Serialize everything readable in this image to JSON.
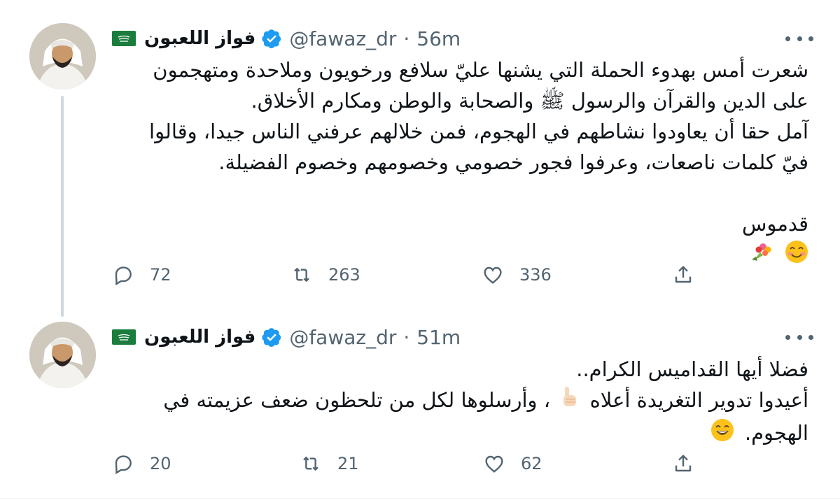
{
  "tweets": [
    {
      "author_name": "فواز اللعبون",
      "handle": "@fawaz_dr",
      "separator": "·",
      "time": "56m",
      "flag_icon": "saudi-flag-icon",
      "lines": [
        "شعرت أمس بهدوء الحملة التي يشنها عليّ سلافع ورخويون وملاحدة ومتهجمون",
        "على الدين والقرآن والرسول ﷺ والصحابة والوطن ومكارم الأخلاق.",
        "آمل حقا أن يعاودوا نشاطهم في الهجوم، فمن خلالهم عرفني الناس جيدا، وقالوا",
        "فيّ كلمات ناصعات، وعرفوا فجور خصومي وخصومهم وخصوم الفضيلة.",
        "",
        "قدموس"
      ],
      "emoji_line": [
        "smiling-face-emoji",
        "bouquet-emoji"
      ],
      "replies": "72",
      "retweets": "263",
      "likes": "336"
    },
    {
      "author_name": "فواز اللعبون",
      "handle": "@fawaz_dr",
      "separator": "·",
      "time": "51m",
      "flag_icon": "saudi-flag-icon",
      "lines": [
        "فضلا أيها القداميس الكرام..",
        "أعيدوا تدوير التغريدة أعلاه",
        "، وأرسلوها لكل من تلحظون ضعف عزيمته في",
        "الهجوم."
      ],
      "emoji_inline": [
        "pointing-up-emoji",
        "grinning-face-emoji"
      ],
      "replies": "20",
      "retweets": "21",
      "likes": "62"
    }
  ],
  "colors": {
    "verified": "#1d9bf0",
    "muted": "#536471",
    "flag": "#1a7d3d"
  }
}
